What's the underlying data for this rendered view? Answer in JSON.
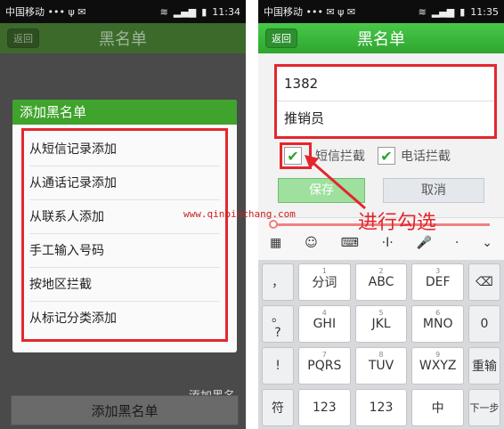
{
  "left": {
    "status": {
      "carrier": "中国移动 ••• ψ ✉",
      "time": "11:34"
    },
    "title": "黑名单",
    "back": "返回",
    "dialog_title": "添加黑名单",
    "menu": [
      "从短信记录添加",
      "从通话记录添加",
      "从联系人添加",
      "手工输入号码",
      "按地区拦截",
      "从标记分类添加"
    ],
    "bottom_button": "添加黑名单",
    "bottom_ghost": "添加黑名"
  },
  "right": {
    "status": {
      "carrier": "中国移动 ••• ✉ ψ ✉",
      "time": "11:35"
    },
    "title": "黑名单",
    "back": "返回",
    "phone_value": "1382",
    "name_value": "推销员",
    "sms_block": "短信拦截",
    "call_block": "电话拦截",
    "save": "保存",
    "cancel": "取消",
    "annotation": "进行勾选",
    "keyboard": {
      "side_keys": [
        "，",
        "。",
        "?",
        "!",
        "符"
      ],
      "rows": [
        [
          "分词",
          "ABC",
          "DEF"
        ],
        [
          "GHI",
          "JKL",
          "MNO"
        ],
        [
          "PQRS",
          "TUV",
          "WXYZ"
        ],
        [
          "123",
          "123",
          "中"
        ]
      ],
      "number_hints": [
        [
          "1",
          "2",
          "3"
        ],
        [
          "4",
          "5",
          "6"
        ],
        [
          "7",
          "8",
          "9"
        ]
      ],
      "right_keys": [
        "⌫",
        "0",
        "重输",
        "下一步"
      ],
      "toolbar": [
        "▦",
        "☺",
        "⌨",
        "·I·",
        "🎤",
        "·",
        "⌄"
      ]
    }
  },
  "watermark": "www.qinbinchang.com"
}
